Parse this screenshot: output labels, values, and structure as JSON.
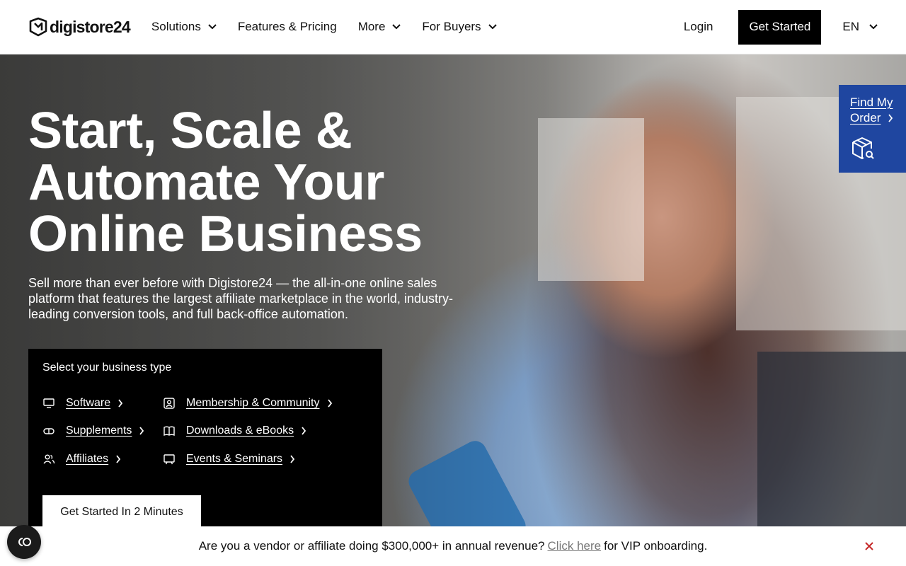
{
  "header": {
    "logo_text": "digistore24",
    "nav": [
      {
        "label": "Solutions",
        "has_dropdown": true
      },
      {
        "label": "Features & Pricing",
        "has_dropdown": false
      },
      {
        "label": "More",
        "has_dropdown": true
      },
      {
        "label": "For Buyers",
        "has_dropdown": true
      }
    ],
    "login_label": "Login",
    "get_started_label": "Get Started",
    "language": "EN"
  },
  "hero": {
    "title_lines": [
      "Start, Scale &",
      "Automate Your",
      "Online Business"
    ],
    "subtitle": "Sell more than ever before with Digistore24 — the all-in-one online sales platform that features the largest affiliate marketplace in the world, industry-leading conversion tools, and full back-office automation."
  },
  "business_panel": {
    "title": "Select your business type",
    "items": [
      {
        "label": "Software",
        "icon": "monitor-icon"
      },
      {
        "label": "Membership & Community",
        "icon": "member-card-icon"
      },
      {
        "label": "Supplements",
        "icon": "capsule-icon"
      },
      {
        "label": "Downloads & eBooks",
        "icon": "book-icon"
      },
      {
        "label": "Affiliates",
        "icon": "users-icon"
      },
      {
        "label": "Events & Seminars",
        "icon": "presentation-icon"
      }
    ],
    "cta_label": "Get Started In 2 Minutes"
  },
  "find_order": {
    "line1": "Find My",
    "line2": "Order",
    "icon": "package-search-icon"
  },
  "banner": {
    "text_before": "Are you a vendor or affiliate doing $300,000+ in annual revenue?",
    "link_text": "Click here",
    "text_after": "for VIP onboarding."
  },
  "colors": {
    "brand_black": "#000000",
    "find_order_blue": "#1f46a0",
    "banner_link_gray": "#777777"
  }
}
